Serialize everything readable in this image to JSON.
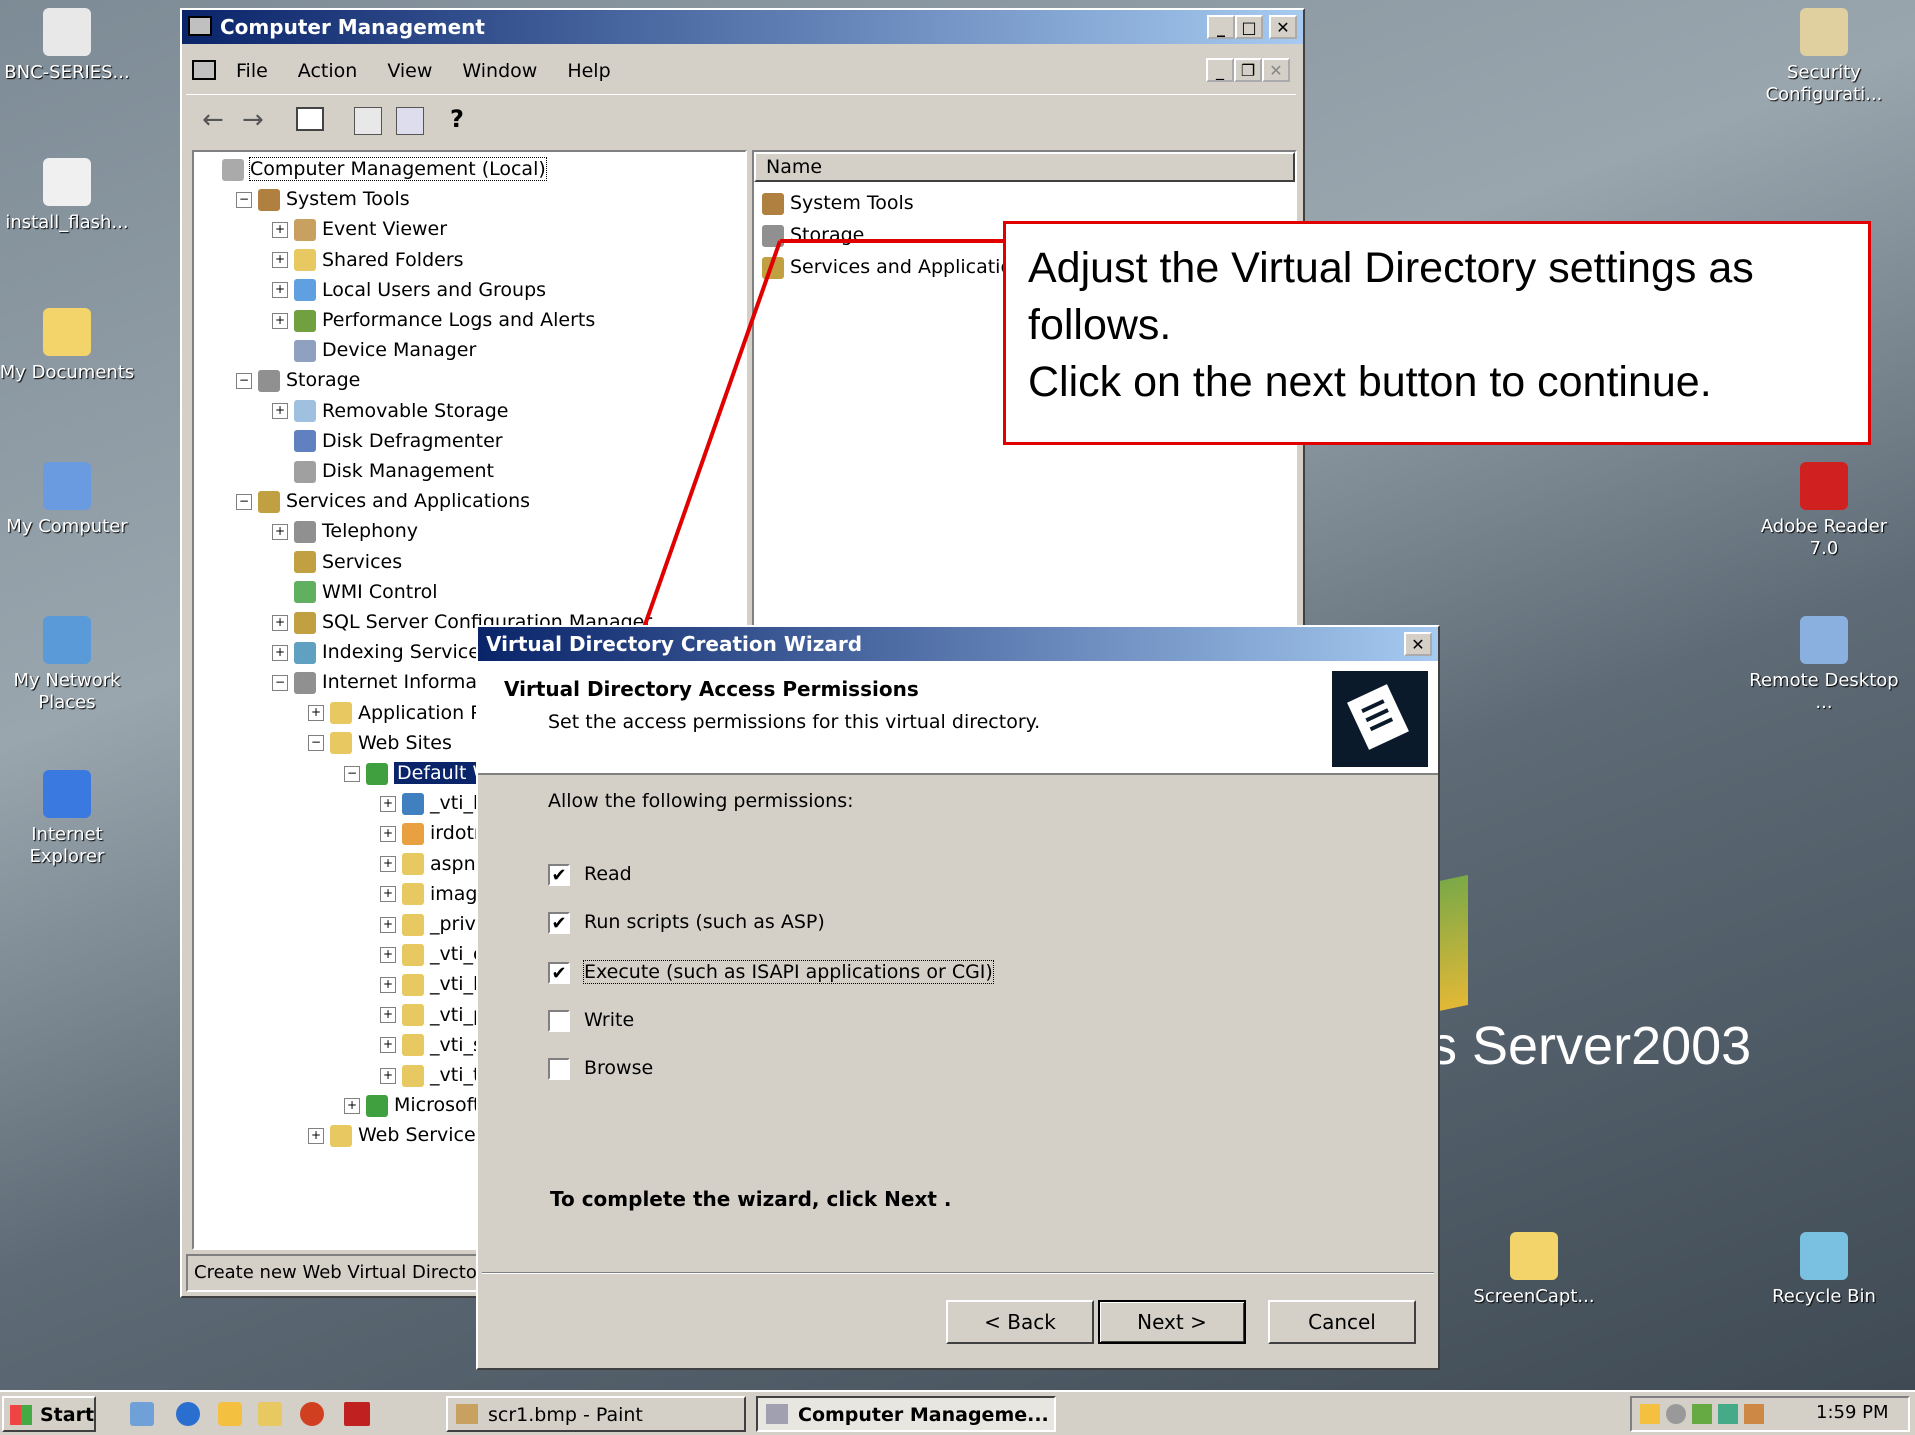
{
  "desktop": {
    "icons_left": [
      {
        "label": "BNC-SERIES...",
        "icon": "pdf-file-icon"
      },
      {
        "label": "install_flash...",
        "icon": "installer-file-icon"
      },
      {
        "label": "My Documents",
        "icon": "folder-documents-icon"
      },
      {
        "label": "My Computer",
        "icon": "my-computer-icon"
      },
      {
        "label": "My Network Places",
        "icon": "network-places-icon"
      },
      {
        "label": "Internet Explorer",
        "icon": "internet-explorer-icon"
      }
    ],
    "icons_right": [
      {
        "label": "Security Configurati...",
        "icon": "security-config-icon"
      },
      {
        "label": "Adobe Reader 7.0",
        "icon": "adobe-reader-icon"
      },
      {
        "label": "Remote Desktop ...",
        "icon": "remote-desktop-icon"
      },
      {
        "label": "ScreenCapt...",
        "icon": "folder-icon"
      },
      {
        "label": "Recycle Bin",
        "icon": "recycle-bin-icon"
      }
    ],
    "wallpaper_text": "s Server",
    "wallpaper_year": "2003"
  },
  "main_window": {
    "title": "Computer Management",
    "menu": [
      "File",
      "Action",
      "View",
      "Window",
      "Help"
    ],
    "tree": [
      {
        "label": "Computer Management (Local)",
        "depth": 0,
        "expander": ""
      },
      {
        "label": "System Tools",
        "depth": 1,
        "expander": "−"
      },
      {
        "label": "Event Viewer",
        "depth": 2,
        "expander": "+"
      },
      {
        "label": "Shared Folders",
        "depth": 2,
        "expander": "+"
      },
      {
        "label": "Local Users and Groups",
        "depth": 2,
        "expander": "+"
      },
      {
        "label": "Performance Logs and Alerts",
        "depth": 2,
        "expander": "+"
      },
      {
        "label": "Device Manager",
        "depth": 2,
        "expander": ""
      },
      {
        "label": "Storage",
        "depth": 1,
        "expander": "−"
      },
      {
        "label": "Removable Storage",
        "depth": 2,
        "expander": "+"
      },
      {
        "label": "Disk Defragmenter",
        "depth": 2,
        "expander": ""
      },
      {
        "label": "Disk Management",
        "depth": 2,
        "expander": ""
      },
      {
        "label": "Services and Applications",
        "depth": 1,
        "expander": "−"
      },
      {
        "label": "Telephony",
        "depth": 2,
        "expander": "+"
      },
      {
        "label": "Services",
        "depth": 2,
        "expander": ""
      },
      {
        "label": "WMI Control",
        "depth": 2,
        "expander": ""
      },
      {
        "label": "SQL Server Configuration Manager",
        "depth": 2,
        "expander": "+"
      },
      {
        "label": "Indexing Service",
        "depth": 2,
        "expander": "+"
      },
      {
        "label": "Internet Informatic",
        "depth": 2,
        "expander": "−"
      },
      {
        "label": "Application Poo",
        "depth": 3,
        "expander": "+"
      },
      {
        "label": "Web Sites",
        "depth": 3,
        "expander": "−"
      },
      {
        "label": "Default We",
        "depth": 4,
        "expander": "−",
        "selected": true
      },
      {
        "label": "_vti_bir",
        "depth": 5,
        "expander": "+"
      },
      {
        "label": "irdotne",
        "depth": 5,
        "expander": "+"
      },
      {
        "label": "aspnet",
        "depth": 5,
        "expander": "+"
      },
      {
        "label": "images",
        "depth": 5,
        "expander": "+"
      },
      {
        "label": "_privat",
        "depth": 5,
        "expander": "+"
      },
      {
        "label": "_vti_cn",
        "depth": 5,
        "expander": "+"
      },
      {
        "label": "_vti_loc",
        "depth": 5,
        "expander": "+"
      },
      {
        "label": "_vti_pv",
        "depth": 5,
        "expander": "+"
      },
      {
        "label": "_vti_sc",
        "depth": 5,
        "expander": "+"
      },
      {
        "label": "_vti_tx",
        "depth": 5,
        "expander": "+"
      },
      {
        "label": "Microsoft S",
        "depth": 4,
        "expander": "+"
      },
      {
        "label": "Web Service Ex",
        "depth": 3,
        "expander": "+"
      }
    ],
    "list_header": "Name",
    "list_items": [
      "System Tools",
      "Storage",
      "Services and Application"
    ],
    "status_text": "Create new Web Virtual Director"
  },
  "callout": {
    "line1": "Adjust the Virtual Directory settings as follows.",
    "line2": "Click on the next button to continue."
  },
  "wizard": {
    "title": "Virtual Directory Creation Wizard",
    "heading": "Virtual Directory Access Permissions",
    "subheading": "Set the access permissions for this virtual directory.",
    "allow_label": "Allow the following permissions:",
    "permissions": [
      {
        "label": "Read",
        "checked": true
      },
      {
        "label": "Run scripts (such as ASP)",
        "checked": true
      },
      {
        "label": "Execute (such as ISAPI applications or CGI)",
        "checked": true
      },
      {
        "label": "Write",
        "checked": false
      },
      {
        "label": "Browse",
        "checked": false
      }
    ],
    "complete_text": "To complete the wizard, click Next .",
    "back_label": "< Back",
    "next_label": "Next >",
    "cancel_label": "Cancel",
    "close_glyph": "✕"
  },
  "taskbar": {
    "start_label": "Start",
    "tasks": [
      "scr1.bmp - Paint",
      "Computer Manageme..."
    ],
    "clock": "1:59 PM"
  },
  "colors": {
    "accent_red": "#e00000",
    "title_blue": "#0a246a",
    "selection_blue": "#0a246a"
  }
}
